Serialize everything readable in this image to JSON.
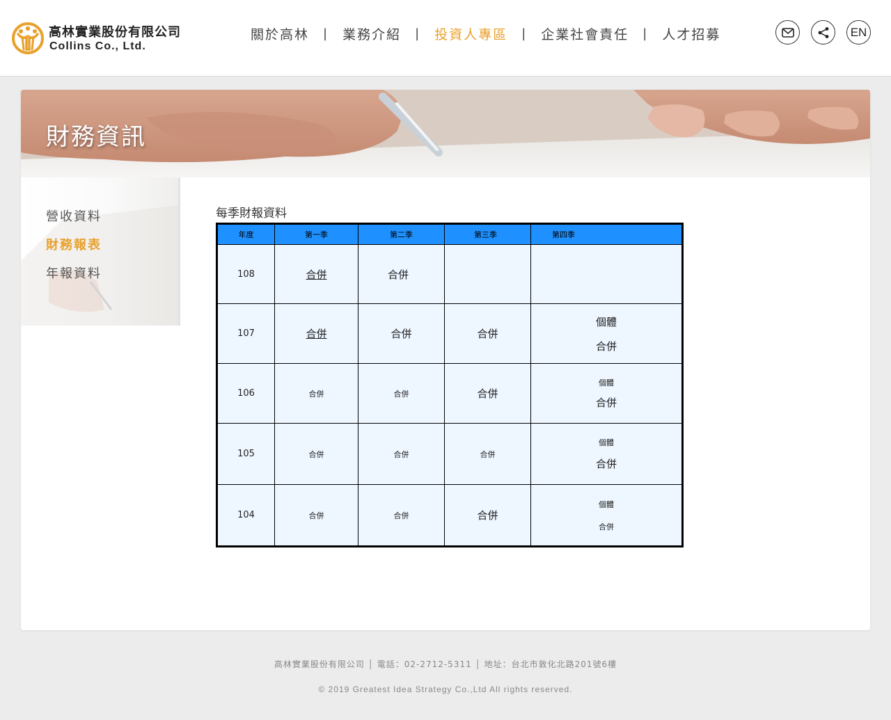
{
  "logo": {
    "name_cn": "高林實業股份有限公司",
    "name_en": "Collins Co., Ltd."
  },
  "nav": {
    "items": [
      {
        "label": "關於高林"
      },
      {
        "label": "業務介紹"
      },
      {
        "label": "投資人專區"
      },
      {
        "label": "企業社會責任"
      },
      {
        "label": "人才招募"
      }
    ],
    "separator": "|",
    "language_label": "EN"
  },
  "banner": {
    "title": "財務資訊"
  },
  "sidebar": {
    "items": [
      {
        "label": "營收資料"
      },
      {
        "label": "財務報表"
      },
      {
        "label": "年報資料"
      }
    ]
  },
  "main": {
    "section_title": "每季財報資料",
    "table": {
      "headers": [
        "年度",
        "第一季",
        "第二季",
        "第三季",
        "第四季"
      ],
      "rows": [
        {
          "year": "108",
          "q1": "合併",
          "q2": "合併",
          "q3": "",
          "q4_a": "",
          "q4_b": ""
        },
        {
          "year": "107",
          "q1": "合併",
          "q2": "合併",
          "q3": "合併",
          "q4_a": "個體",
          "q4_b": "合併"
        },
        {
          "year": "106",
          "q1": "合併",
          "q2": "合併",
          "q3": "合併",
          "q4_a": "個體",
          "q4_b": "合併"
        },
        {
          "year": "105",
          "q1": "合併",
          "q2": "合併",
          "q3": "合併",
          "q4_a": "個體",
          "q4_b": "合併"
        },
        {
          "year": "104",
          "q1": "合併",
          "q2": "合併",
          "q3": "合併",
          "q4_a": "個體",
          "q4_b": "合併"
        }
      ]
    }
  },
  "footer": {
    "line1": "高林實業股份有限公司 │ 電話：02-2712-5311 │ 地址：台北市敦化北路201號6樓",
    "line2": "© 2019 Greatest Idea Strategy Co.,Ltd All rights reserved."
  },
  "colors": {
    "accent": "#e8a12c",
    "table_header": "#1e90ff",
    "table_body": "#eef6ff"
  },
  "icons": [
    "logo-mark-icon",
    "mail-icon",
    "share-icon"
  ]
}
